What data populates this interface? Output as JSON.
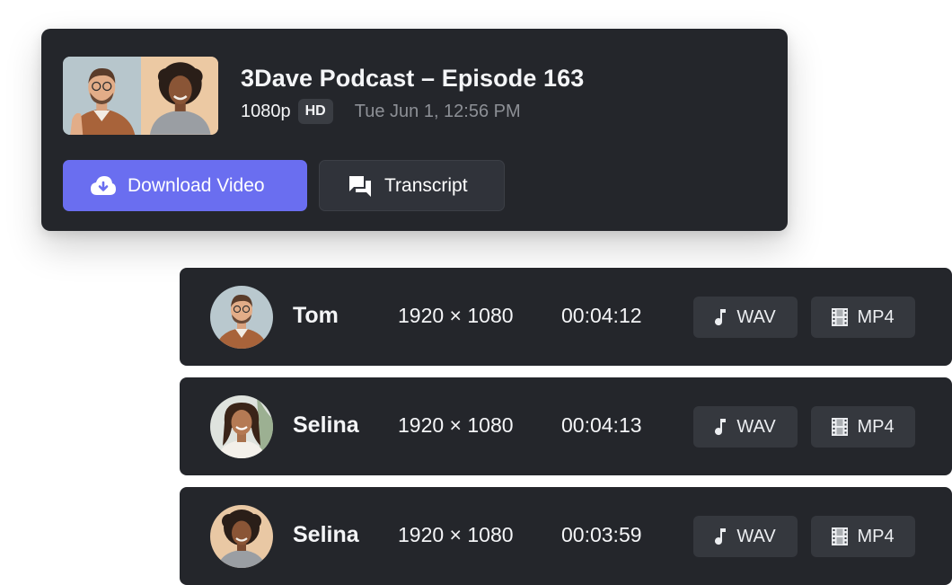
{
  "episode": {
    "title": "3Dave Podcast – Episode 163",
    "resolution": "1080p",
    "quality_badge": "HD",
    "date": "Tue Jun 1, 12:56 PM",
    "download_label": "Download Video",
    "transcript_label": "Transcript",
    "icons": [
      "cloud-download-icon",
      "chat-bubbles-icon"
    ]
  },
  "colors": {
    "card_bg": "#24262b",
    "accent": "#6a6ef0",
    "text_primary": "#f4f5f7",
    "text_muted": "#8d9096",
    "format_button_bg": "#35383e"
  },
  "tracks": [
    {
      "name": "Tom",
      "resolution": "1920 × 1080",
      "duration": "00:04:12",
      "audio_label": "WAV",
      "video_label": "MP4"
    },
    {
      "name": "Selina",
      "resolution": "1920 × 1080",
      "duration": "00:04:13",
      "audio_label": "WAV",
      "video_label": "MP4"
    },
    {
      "name": "Selina",
      "resolution": "1920 × 1080",
      "duration": "00:03:59",
      "audio_label": "WAV",
      "video_label": "MP4"
    }
  ]
}
